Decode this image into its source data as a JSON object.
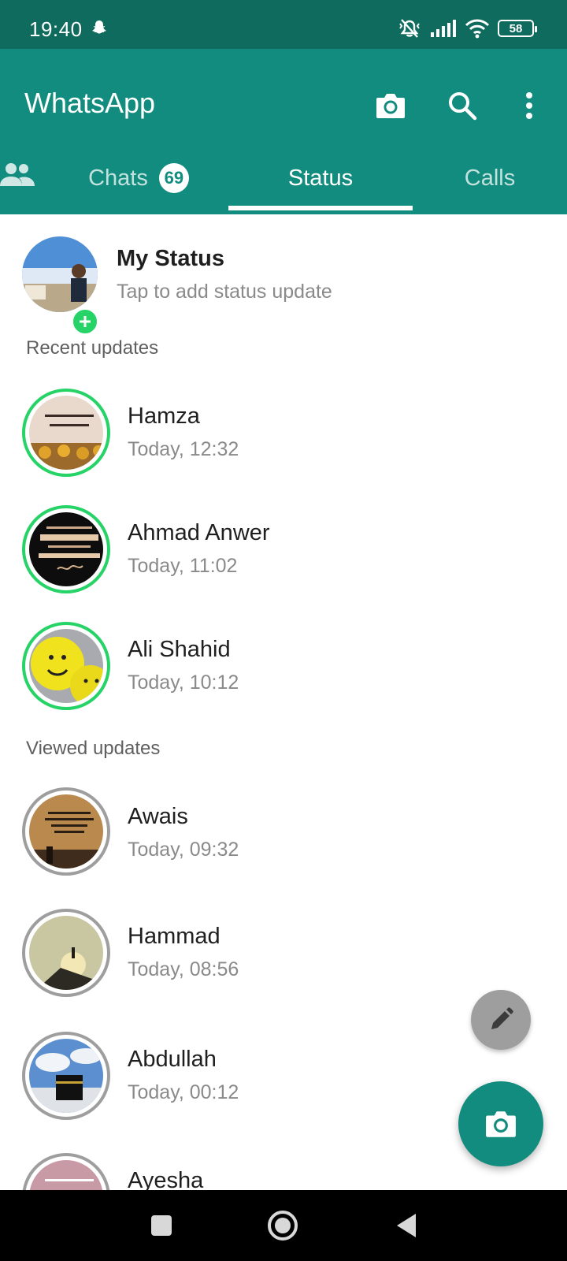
{
  "status_bar": {
    "time": "19:40",
    "battery": "58"
  },
  "app": {
    "title": "WhatsApp"
  },
  "tabs": [
    {
      "label": "Chats",
      "badge": "69"
    },
    {
      "label": "Status"
    },
    {
      "label": "Calls"
    }
  ],
  "my_status": {
    "name": "My Status",
    "subtitle": "Tap to add status update"
  },
  "sections": {
    "recent": "Recent updates",
    "viewed": "Viewed updates"
  },
  "recent_updates": [
    {
      "name": "Hamza",
      "time": "Today, 12:32"
    },
    {
      "name": "Ahmad Anwer",
      "time": "Today, 11:02"
    },
    {
      "name": "Ali Shahid",
      "time": "Today, 10:12"
    }
  ],
  "viewed_updates": [
    {
      "name": "Awais",
      "time": "Today, 09:32"
    },
    {
      "name": "Hammad",
      "time": "Today, 08:56"
    },
    {
      "name": "Abdullah",
      "time": "Today, 00:12"
    },
    {
      "name": "Ayesha",
      "time": ""
    }
  ],
  "icons": {
    "status_bar": [
      "snapchat-icon",
      "mute-vibrate-icon",
      "signal-icon",
      "wifi-icon",
      "battery-icon"
    ],
    "app_bar": [
      "camera-icon",
      "search-icon",
      "more-vert-icon"
    ],
    "tabs": [
      "community-icon"
    ],
    "fabs": [
      "pencil-icon",
      "camera-icon"
    ],
    "navigation": [
      "recents-icon",
      "home-icon",
      "back-icon"
    ]
  },
  "colors": {
    "brand": "#128c7e",
    "status_bar": "#0f6b5e",
    "unseen_ring": "#25d366",
    "seen_ring": "#9e9e9e"
  }
}
